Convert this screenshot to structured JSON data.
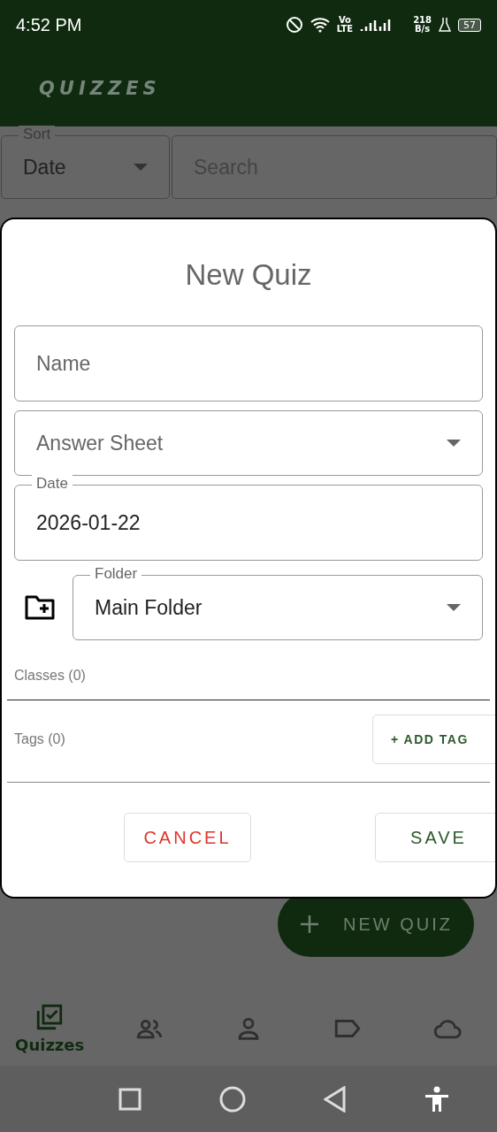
{
  "status_bar": {
    "time": "4:52 PM",
    "network": "Vo\nLTE",
    "speed": "218\nB/s",
    "battery": "57"
  },
  "app_bar": {
    "title": "QUIZZES"
  },
  "filters": {
    "sort": {
      "label": "Sort",
      "value": "Date"
    },
    "search": {
      "placeholder": "Search"
    }
  },
  "fab": {
    "label": "NEW QUIZ"
  },
  "dialog": {
    "title": "New Quiz",
    "fields": [
      {
        "kind": "text",
        "placeholder": "Name"
      },
      {
        "kind": "select",
        "placeholder": "Answer Sheet"
      },
      {
        "kind": "text",
        "label": "Date",
        "value": "2026-01-22"
      },
      {
        "kind": "folder",
        "label": "Folder",
        "value": "Main Folder"
      }
    ],
    "classes": "Classes (0)",
    "tags": "Tags (0)",
    "add_tag": "+ ADD TAG",
    "cancel": "CANCEL",
    "save": "SAVE"
  },
  "bottom_nav": [
    {
      "kind": "quizzes",
      "label": "Quizzes",
      "selected": true
    },
    {
      "kind": "people",
      "selected": false
    },
    {
      "kind": "person",
      "selected": false
    },
    {
      "kind": "tag",
      "selected": false
    },
    {
      "kind": "cloud",
      "selected": false
    }
  ]
}
